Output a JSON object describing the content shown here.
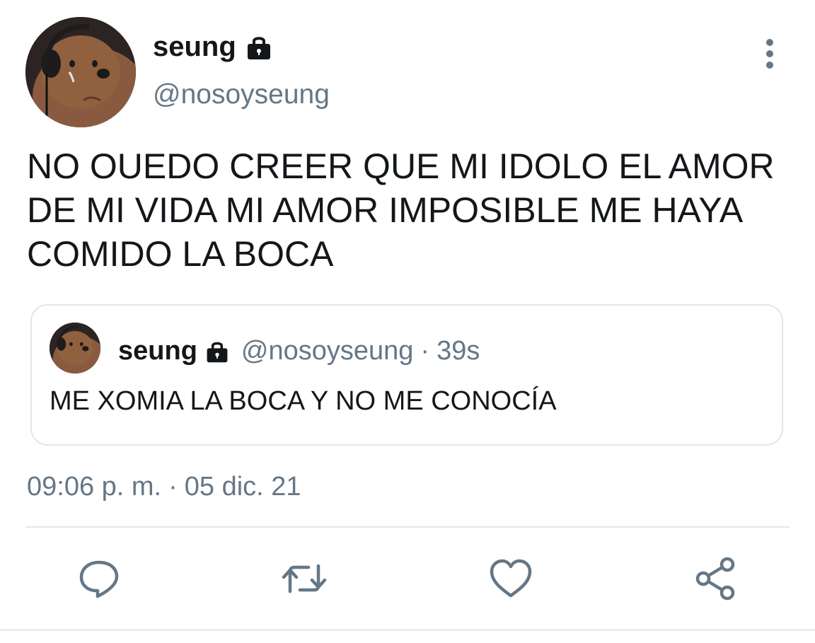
{
  "tweet": {
    "author": {
      "display_name": "seung",
      "handle": "@nosoyseung",
      "protected_icon": "lock-icon"
    },
    "text": "NO OUEDO CREER QUE MI IDOLO EL AMOR DE MI VIDA MI AMOR IMPOSIBLE ME HAYA COMIDO LA BOCA",
    "timestamp": {
      "time": "09:06 p. m.",
      "separator": "·",
      "date": "05 dic. 21"
    }
  },
  "quoted_tweet": {
    "display_name": "seung",
    "handle": "@nosoyseung",
    "separator": "·",
    "age": "39s",
    "text": "ME XOMIA LA BOCA Y NO ME CONOCÍA"
  },
  "actions": [
    "reply-icon",
    "retweet-icon",
    "like-icon",
    "share-icon"
  ],
  "colors": {
    "text": "#14171a",
    "secondary": "#657786",
    "border": "#e1e8ed"
  }
}
